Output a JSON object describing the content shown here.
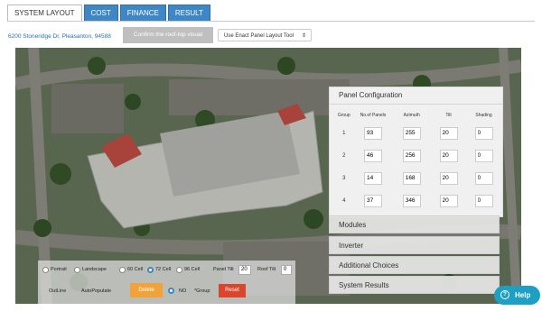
{
  "tabs": [
    "SYSTEM LAYOUT",
    "COST",
    "FINANCE",
    "RESULT"
  ],
  "address": "6200 Stoneridge Dr, Pleasanton, 94588",
  "confirm_label": "Confirm the roof-top visual",
  "tool_select": "Use Enact Panel Layout Tool",
  "panel_config": {
    "title": "Panel Configuration",
    "columns": [
      "Group",
      "No.of Panels",
      "Azimuth",
      "Tilt",
      "Shading"
    ],
    "rows": [
      {
        "group": "1",
        "panels": "93",
        "azimuth": "255",
        "tilt": "20",
        "shading": "0"
      },
      {
        "group": "2",
        "panels": "46",
        "azimuth": "256",
        "tilt": "20",
        "shading": "0"
      },
      {
        "group": "3",
        "panels": "14",
        "azimuth": "168",
        "tilt": "20",
        "shading": "0"
      },
      {
        "group": "4",
        "panels": "37",
        "azimuth": "346",
        "tilt": "20",
        "shading": "0"
      }
    ]
  },
  "accordion": [
    "Modules",
    "Inverter",
    "Additional Choices",
    "System Results"
  ],
  "controls": {
    "portrait": "Portrait",
    "landscape": "Landscape",
    "cell60": "60 Cell",
    "cell72": "72 Cell",
    "cell96": "96 Cell",
    "panel_tilt_label": "Panel Tilt",
    "panel_tilt_value": "20",
    "roof_tilt_label": "Roof Tilt",
    "roof_tilt_value": "0",
    "outline": "OutLine",
    "autopopulate": "AutoPopulate",
    "delete": "Delete",
    "no": "NO",
    "group": "*Group",
    "reset": "Reset"
  },
  "help": "Help",
  "colors": {
    "accent": "#3f86c5",
    "delete": "#f1a33b",
    "reset": "#d9452d",
    "help": "#1e9fc4"
  }
}
